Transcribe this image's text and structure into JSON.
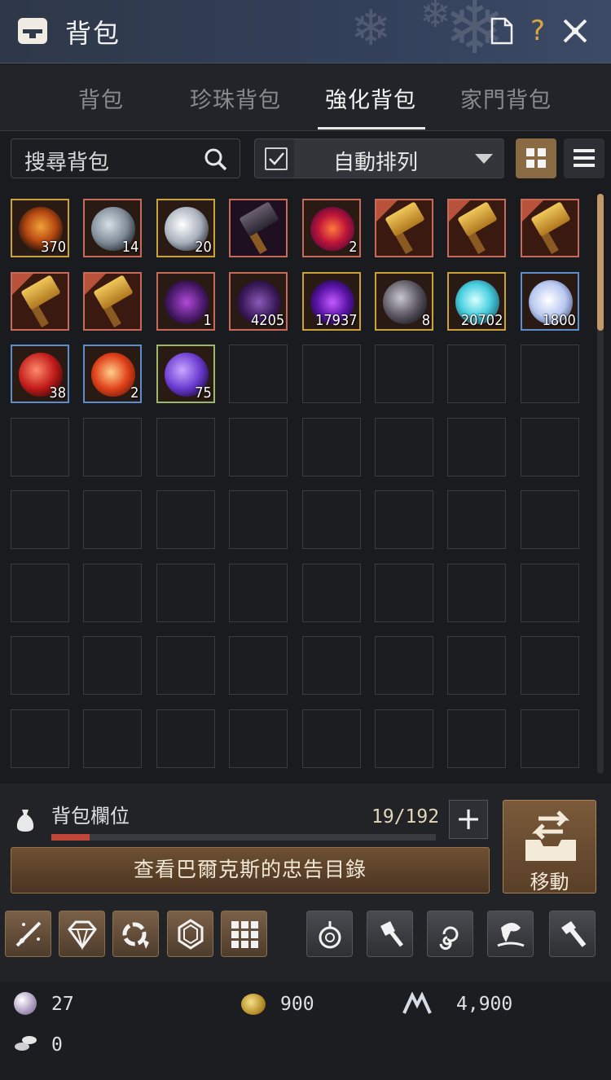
{
  "header": {
    "title": "背包",
    "help_label": "?"
  },
  "tabs": [
    {
      "label": "背包"
    },
    {
      "label": "珍珠背包"
    },
    {
      "label": "強化背包"
    },
    {
      "label": "家門背包"
    }
  ],
  "active_tab": "強化背包",
  "search": {
    "placeholder": "搜尋背包"
  },
  "sort": {
    "checked": true,
    "selected": "自動排列"
  },
  "inventory": {
    "items": [
      {
        "name": "black-stone-orb",
        "count": "370",
        "border": "#c9a33a",
        "flag": false
      },
      {
        "name": "gray-stone",
        "count": "14",
        "border": "#c66a5a",
        "flag": false
      },
      {
        "name": "silver-stone",
        "count": "20",
        "border": "#c9a33a",
        "flag": false
      },
      {
        "name": "dark-hammer",
        "count": "",
        "border": "#c66a5a",
        "flag": false
      },
      {
        "name": "red-crystal",
        "count": "2",
        "border": "#c66a5a",
        "flag": false
      },
      {
        "name": "golden-hammer",
        "count": "",
        "border": "#c66a5a",
        "flag": true
      },
      {
        "name": "golden-hammer",
        "count": "",
        "border": "#c66a5a",
        "flag": true
      },
      {
        "name": "golden-hammer",
        "count": "",
        "border": "#c66a5a",
        "flag": true
      },
      {
        "name": "golden-hammer",
        "count": "",
        "border": "#c66a5a",
        "flag": true
      },
      {
        "name": "golden-hammer",
        "count": "",
        "border": "#c66a5a",
        "flag": true
      },
      {
        "name": "purple-claw",
        "count": "1",
        "border": "#c66a5a",
        "flag": false
      },
      {
        "name": "purple-shard",
        "count": "4205",
        "border": "#c66a5a",
        "flag": false
      },
      {
        "name": "purple-orb",
        "count": "17937",
        "border": "#c9a33a",
        "flag": false
      },
      {
        "name": "dark-stone",
        "count": "8",
        "border": "#c9a33a",
        "flag": false
      },
      {
        "name": "cyan-orb",
        "count": "20702",
        "border": "#c9a33a",
        "flag": false
      },
      {
        "name": "crystal-cluster",
        "count": "1800",
        "border": "#5b8ecb",
        "flag": false
      },
      {
        "name": "red-stone",
        "count": "38",
        "border": "#5b8ecb",
        "flag": false
      },
      {
        "name": "fire-orb",
        "count": "2",
        "border": "#5b8ecb",
        "flag": false
      },
      {
        "name": "violet-stone",
        "count": "75",
        "border": "#9bb86a",
        "flag": false
      }
    ],
    "total_slots": 64
  },
  "capacity": {
    "label": "背包欄位",
    "count": "19/192",
    "used": 19,
    "max": 192,
    "plus_label": "+"
  },
  "advice_button": "查看巴爾克斯的忠告目錄",
  "move_button": "移動",
  "skill_icons": [
    "sword-sparkle-icon",
    "diamond-icon",
    "cycle-icon",
    "gem-icon",
    "grid-icon",
    "pendant-icon",
    "hammer-icon",
    "swirl-icon",
    "fish-icon",
    "smith-hammer-icon"
  ],
  "currency": {
    "pearl": "27",
    "gold": "900",
    "mountain": "4,900",
    "ore": "0"
  },
  "colors": {
    "accent": "#8a6a43",
    "capacity_fill": "#c0463a"
  }
}
